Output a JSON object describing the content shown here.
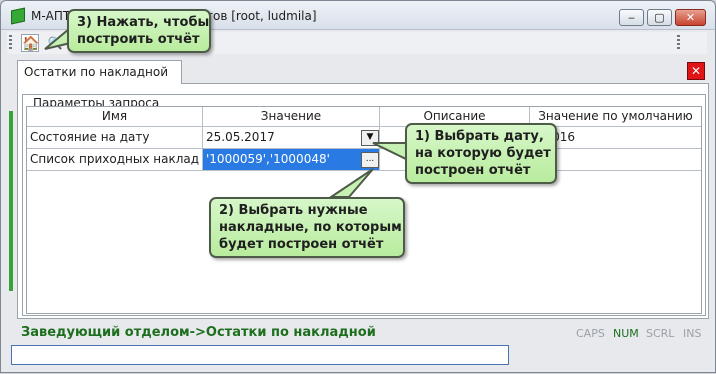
{
  "window": {
    "title_left": "М-АПТ",
    "title_right": "тов [root, ludmila]",
    "minimize": "‒",
    "maximize": "▢",
    "close": "✕"
  },
  "toolbar": {
    "report_icon": "🏠",
    "preview_icon": "🔍"
  },
  "tab": {
    "label": "Остатки по накладной",
    "close": "✕"
  },
  "group": {
    "legend": "Параметры запроса"
  },
  "grid": {
    "headers": [
      "Имя",
      "Значение",
      "Описание",
      "Значение по умолчанию"
    ],
    "rows": [
      {
        "name": "Состояние на дату",
        "value": "25.05.2017",
        "description": "",
        "default": "7.2016"
      },
      {
        "name": "Список приходных наклад",
        "value": "'1000059','1000048'",
        "description": "",
        "default": ""
      }
    ],
    "dropdown_glyph": "▼",
    "ellipsis_glyph": "..."
  },
  "status": {
    "path": "Заведующий отделом->Остатки по накладной",
    "caps": "CAPS",
    "num": "NUM",
    "scrl": "SCRL",
    "ins": "INS"
  },
  "callouts": {
    "c3_line1": "3) Нажать, чтобы",
    "c3_line2": "построить отчёт",
    "c1_line1": "1) Выбрать дату,",
    "c1_line2": "на которую будет",
    "c1_line3": "построен отчёт",
    "c2_line1": "2) Выбрать нужные",
    "c2_line2": "накладные, по которым",
    "c2_line3": "будет построен отчёт"
  }
}
